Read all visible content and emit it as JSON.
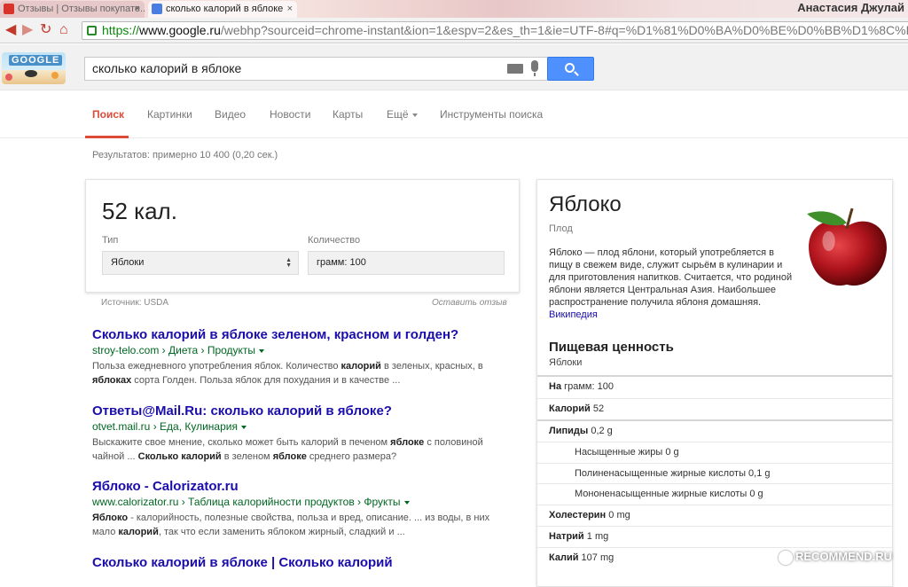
{
  "browser": {
    "tabs": [
      {
        "title": "Отзывы | Отзывы покупате..."
      },
      {
        "title": "сколько калорий в яблоке"
      }
    ],
    "user": "Анастасия Джулай",
    "url_proto": "https://",
    "url_host": "www.google.ru",
    "url_rest": "/webhp?sourceid=chrome-instant&ion=1&espv=2&es_th=1&ie=UTF-8#q=%D1%81%D0%BA%D0%BE%D0%BB%D1%8C%D0%BA%D0%BE"
  },
  "doodle": {
    "text": "GOOGLE"
  },
  "search": {
    "query": "сколько калорий в яблоке"
  },
  "nav": {
    "tabs": [
      "Поиск",
      "Картинки",
      "Видео",
      "Новости",
      "Карты",
      "Ещё",
      "Инструменты поиска"
    ]
  },
  "stats": "Результатов: примерно 10 400 (0,20 сек.)",
  "calc": {
    "value": "52 кал.",
    "type_label": "Тип",
    "type_value": "Яблоки",
    "qty_label": "Количество",
    "qty_value": "грамм: 100",
    "source": "Источник: USDA",
    "feedback": "Оставить отзыв"
  },
  "results": [
    {
      "title": "Сколько калорий в яблоке зеленом, красном и голден?",
      "url": "stroy-telo.com › Диета › Продукты",
      "snippet": [
        {
          "t": "Польза ежедневного употребления яблок. Количество "
        },
        {
          "b": "калорий"
        },
        {
          "t": " в зеленых, красных, "
        },
        {
          "t": "в "
        },
        {
          "b": "яблоках"
        },
        {
          "t": " сорта Голден. Польза яблок для похудания и в качестве ..."
        }
      ]
    },
    {
      "title": "Ответы@Mail.Ru: сколько калорий в яблоке?",
      "url": "otvet.mail.ru › Еда, Кулинария",
      "snippet": [
        {
          "t": "Выскажите свое мнение, сколько может быть калорий в печеном "
        },
        {
          "b": "яблоке"
        },
        {
          "t": " с половиной чайной ... "
        },
        {
          "b": "Сколько калорий"
        },
        {
          "t": " в зеленом "
        },
        {
          "b": "яблоке"
        },
        {
          "t": " среднего размера?"
        }
      ]
    },
    {
      "title": "Яблоко - Calorizator.ru",
      "url": "www.calorizator.ru › Таблица калорийности продуктов › Фрукты",
      "snippet": [
        {
          "b": "Яблоко"
        },
        {
          "t": " - калорийность, полезные свойства, польза и вред, описание. ... из воды, в них мало "
        },
        {
          "b": "калорий"
        },
        {
          "t": ", так что если заменить яблоком жирный, сладкий и ..."
        }
      ]
    },
    {
      "title": "Сколько калорий в яблоке | Сколько калорий",
      "url": "",
      "snippet": []
    }
  ],
  "knowledge": {
    "title": "Яблоко",
    "subtitle": "Плод",
    "description": "Яблоко — плод яблони, который употребляется в пищу в свежем виде, служит сырьём в кулинарии и для приготовления напитков. Считается, что родиной яблони является Центральная Азия. Наибольшее распространение получила яблоня домашняя.",
    "link": "Википедия",
    "nutrition_title": "Пищевая ценность",
    "nutrition_sub": "Яблоки",
    "rows": [
      {
        "label": "На",
        "value": "грамм: 100"
      },
      {
        "label": "Калорий",
        "value": "52"
      },
      {
        "label": "Липиды",
        "value": "0,2 g"
      },
      {
        "label": "",
        "value": "Насыщенные жиры 0 g"
      },
      {
        "label": "",
        "value": "Полиненасыщенные жирные кислоты 0,1 g"
      },
      {
        "label": "",
        "value": "Мононенасыщенные жирные кислоты 0 g"
      },
      {
        "label": "Холестерин",
        "value": "0 mg"
      },
      {
        "label": "Натрий",
        "value": "1 mg"
      },
      {
        "label": "Калий",
        "value": "107 mg"
      }
    ]
  },
  "watermark": "RECOMMEND.RU",
  "colors": {
    "accent": "#dd4b39",
    "link": "#1a0dab",
    "url": "#006621",
    "button": "#4d90fe"
  }
}
